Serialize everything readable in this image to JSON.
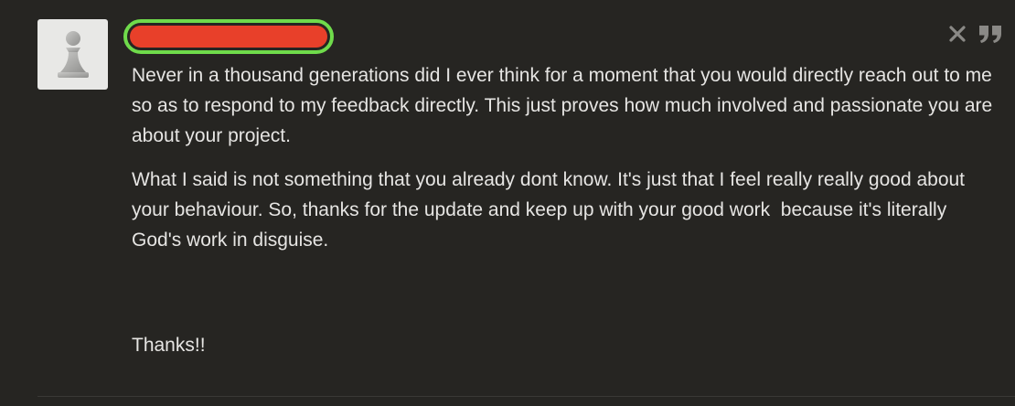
{
  "comment": {
    "avatar_icon": "pawn-icon",
    "username_redacted": true,
    "actions": {
      "close_icon": "close-icon",
      "quote_icon": "quote-icon"
    },
    "paragraphs": [
      "Never in a thousand generations did I ever think for a moment that you would directly reach out to me so as to respond to my feedback directly. This just proves how much involved and passionate you are about your project.",
      "What I said is not something that you already dont know. It's just that I feel really really good about your behaviour. So, thanks for the update and keep up with your good work  because it's literally God's work in disguise.",
      "Thanks!!"
    ]
  },
  "colors": {
    "background": "#262522",
    "text": "#e6e5e3",
    "redaction": "#e8402a",
    "highlight_border": "#6fdb4b",
    "icon": "#8a8986"
  }
}
